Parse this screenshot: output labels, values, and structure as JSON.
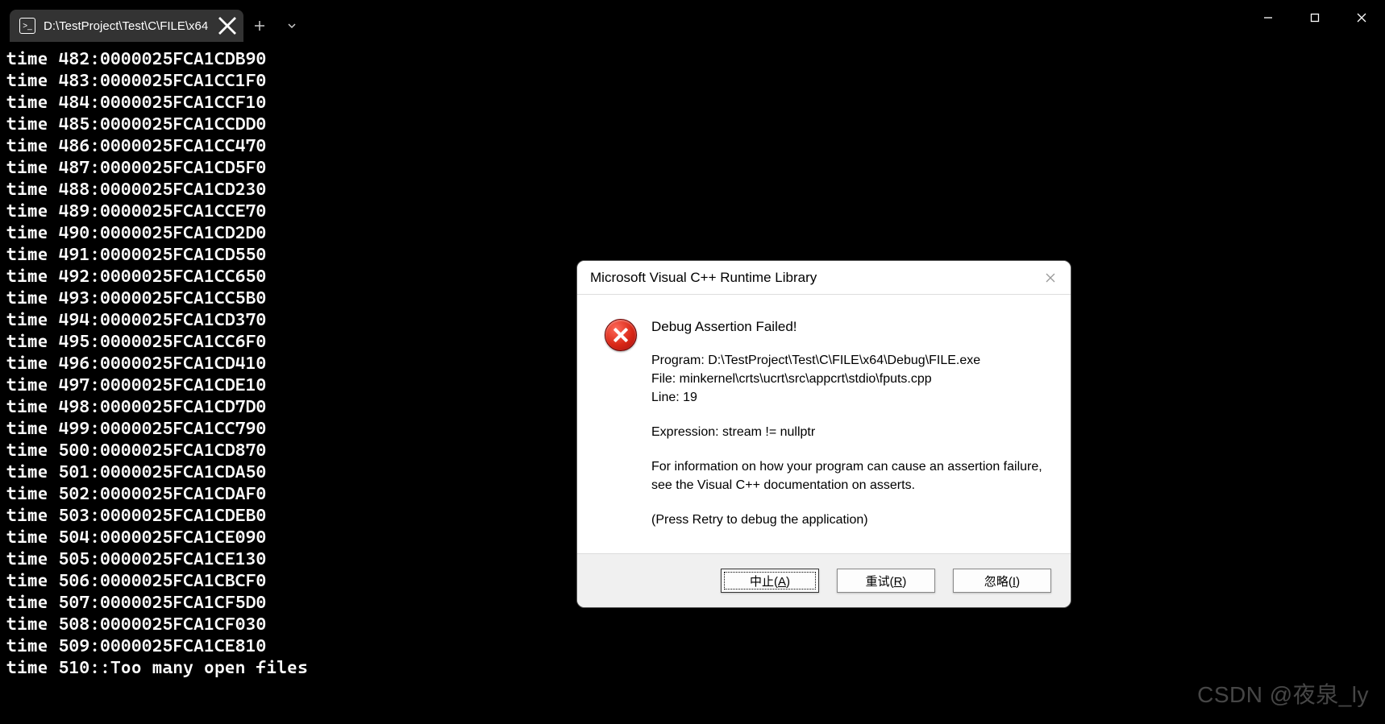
{
  "titlebar": {
    "tab_title": "D:\\TestProject\\Test\\C\\FILE\\x64"
  },
  "console_lines": [
    "time 482:0000025FCA1CDB90",
    "time 483:0000025FCA1CC1F0",
    "time 484:0000025FCA1CCF10",
    "time 485:0000025FCA1CCDD0",
    "time 486:0000025FCA1CC470",
    "time 487:0000025FCA1CD5F0",
    "time 488:0000025FCA1CD230",
    "time 489:0000025FCA1CCE70",
    "time 490:0000025FCA1CD2D0",
    "time 491:0000025FCA1CD550",
    "time 492:0000025FCA1CC650",
    "time 493:0000025FCA1CC5B0",
    "time 494:0000025FCA1CD370",
    "time 495:0000025FCA1CC6F0",
    "time 496:0000025FCA1CD410",
    "time 497:0000025FCA1CDE10",
    "time 498:0000025FCA1CD7D0",
    "time 499:0000025FCA1CC790",
    "time 500:0000025FCA1CD870",
    "time 501:0000025FCA1CDA50",
    "time 502:0000025FCA1CDAF0",
    "time 503:0000025FCA1CDEB0",
    "time 504:0000025FCA1CE090",
    "time 505:0000025FCA1CE130",
    "time 506:0000025FCA1CBCF0",
    "time 507:0000025FCA1CF5D0",
    "time 508:0000025FCA1CF030",
    "time 509:0000025FCA1CE810",
    "time 510::Too many open files"
  ],
  "dialog": {
    "title": "Microsoft Visual C++ Runtime Library",
    "heading": "Debug Assertion Failed!",
    "program": "Program: D:\\TestProject\\Test\\C\\FILE\\x64\\Debug\\FILE.exe",
    "file": "File: minkernel\\crts\\ucrt\\src\\appcrt\\stdio\\fputs.cpp",
    "line": "Line: 19",
    "expression": "Expression: stream != nullptr",
    "info1": "For information on how your program can cause an assertion failure, see the Visual C++ documentation on asserts.",
    "info2": "(Press Retry to debug the application)",
    "buttons": {
      "abort": "中止(A)",
      "retry": "重试(R)",
      "ignore": "忽略(I)"
    }
  },
  "watermark": "CSDN @夜泉_ly"
}
